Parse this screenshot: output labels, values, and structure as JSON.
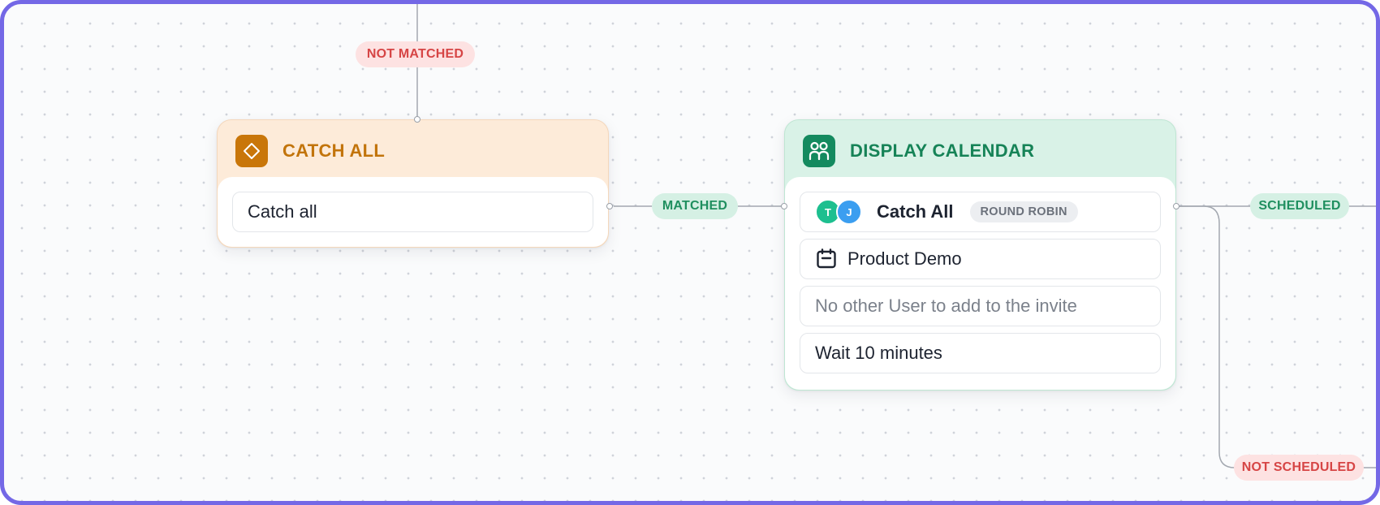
{
  "edges": {
    "not_matched": "NOT MATCHED",
    "matched": "MATCHED",
    "scheduled": "SCHEDULED",
    "not_scheduled": "NOT SCHEDULED"
  },
  "catch_all_node": {
    "title": "CATCH ALL",
    "icon": "diamond-icon",
    "rows": [
      {
        "text": "Catch all"
      }
    ]
  },
  "display_calendar_node": {
    "title": "DISPLAY CALENDAR",
    "icon": "users-group-icon",
    "rows": [
      {
        "avatars": [
          "T",
          "J"
        ],
        "text": "Catch All",
        "badge": "ROUND ROBIN"
      },
      {
        "icon": "calendar-icon",
        "text": "Product Demo"
      },
      {
        "text": "No other User to add to the invite"
      },
      {
        "text": "Wait 10 minutes"
      }
    ]
  },
  "colors": {
    "frame_border": "#7468e6",
    "catch_all_accent": "#c97609",
    "display_calendar_accent": "#148a5f",
    "red_pill": "#d64545",
    "green_pill": "#1f8f5f"
  }
}
